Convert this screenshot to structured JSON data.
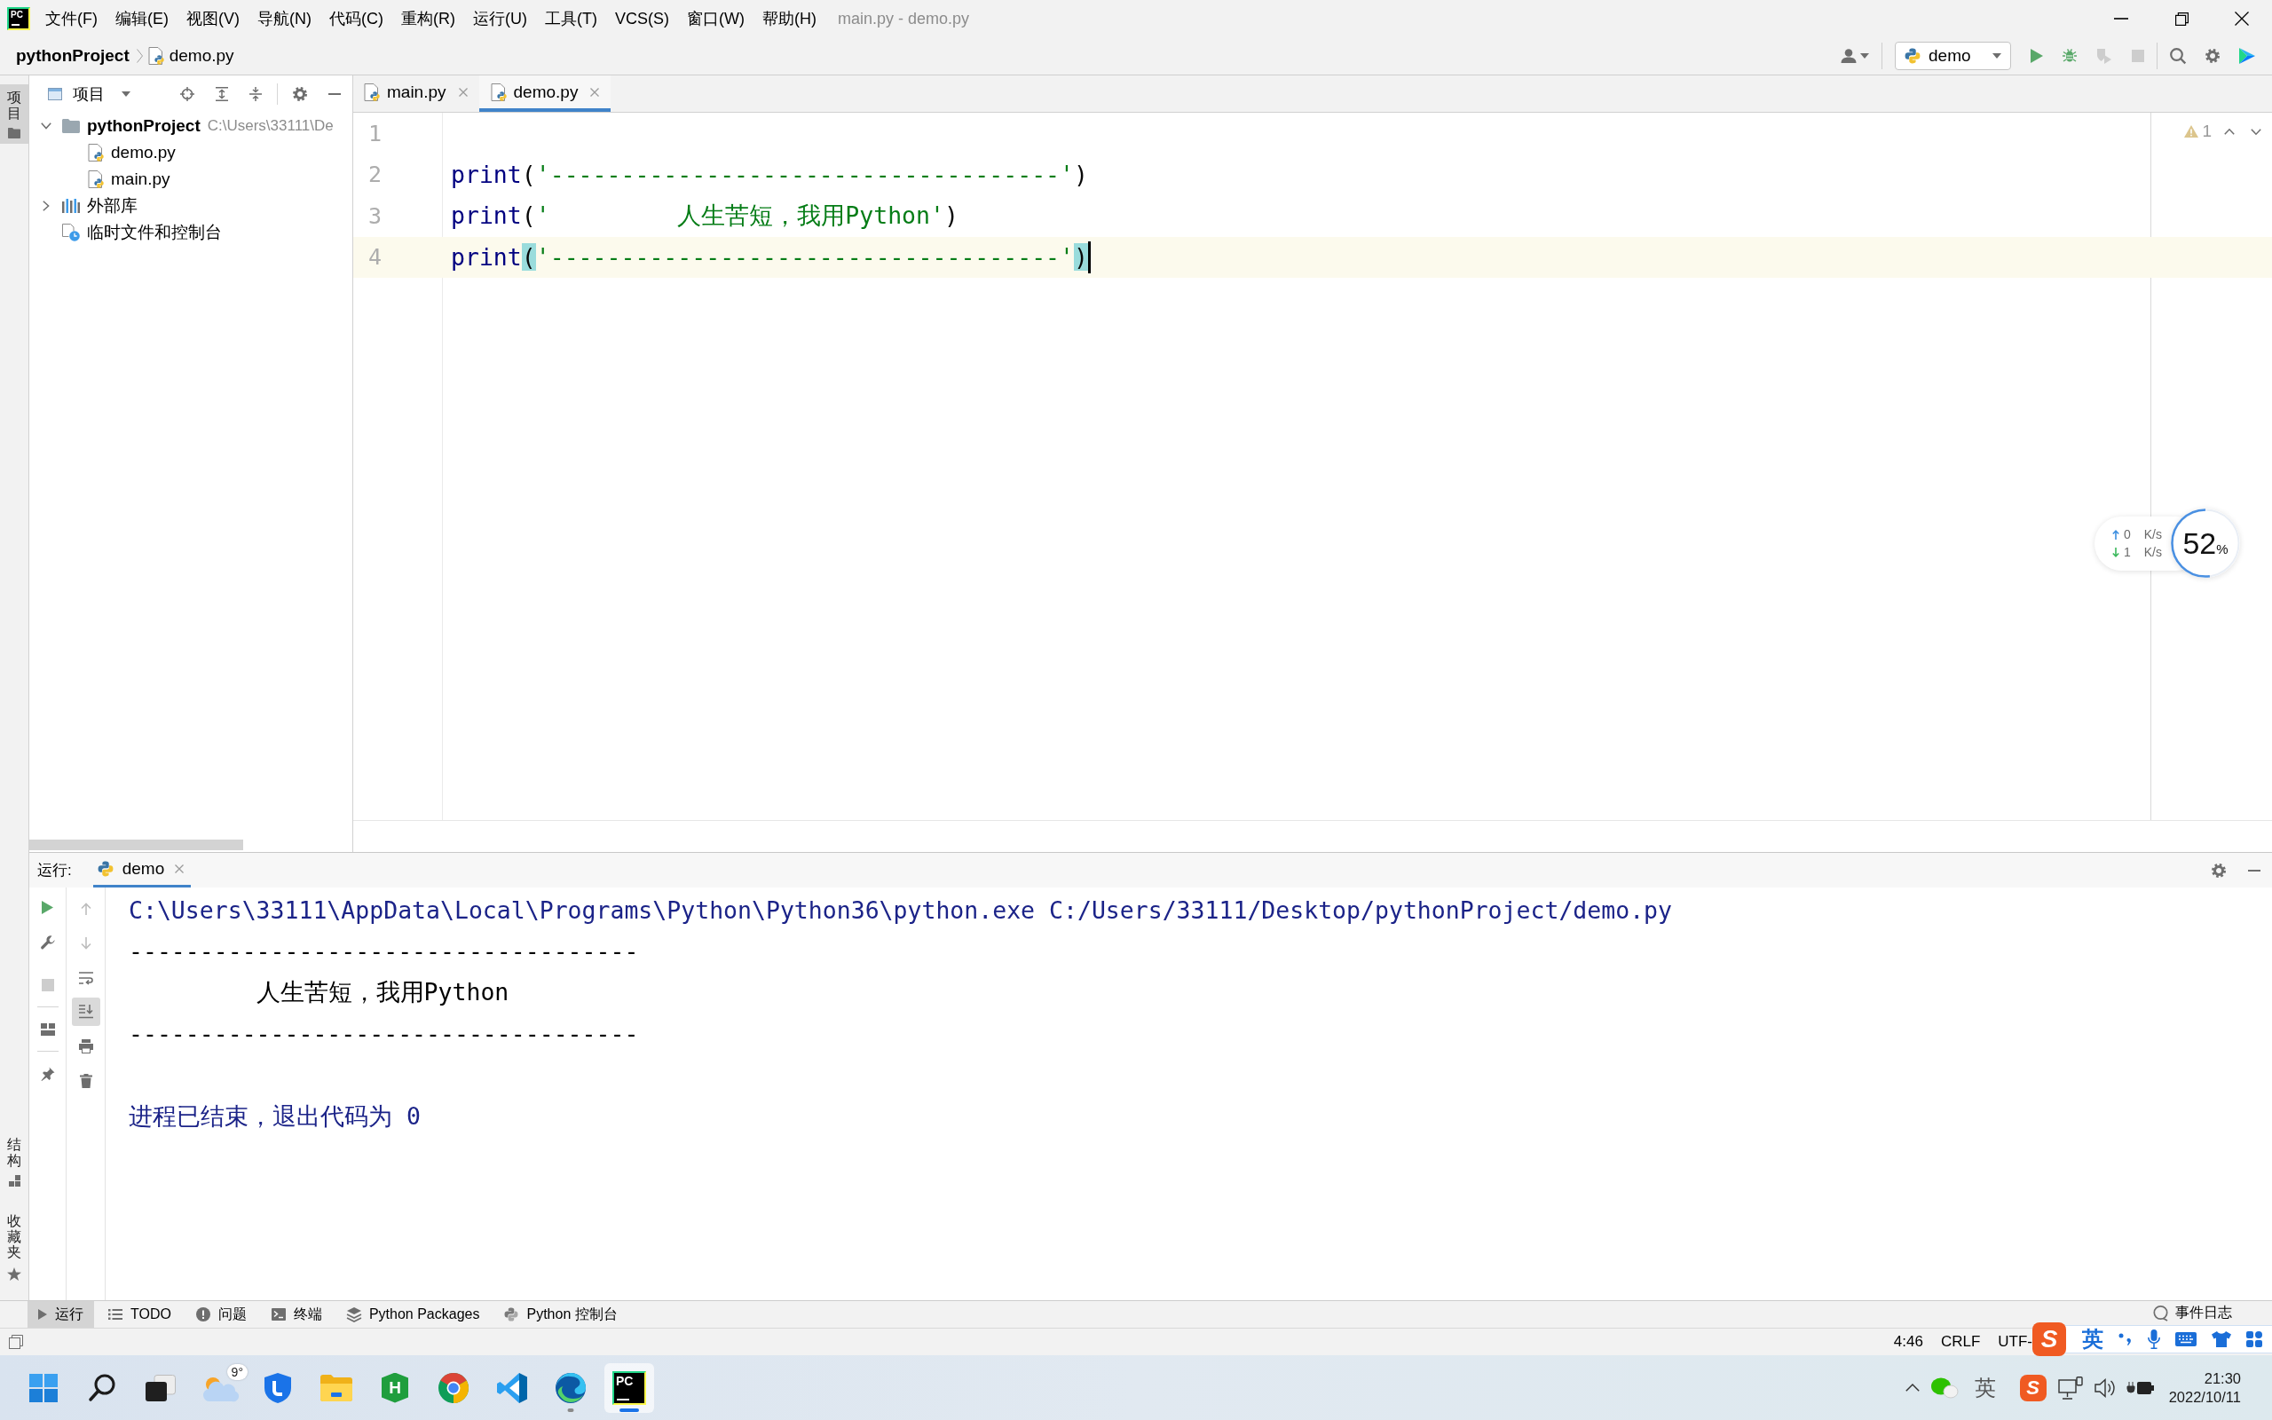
{
  "title_bar": {
    "logo": "PC",
    "menu": [
      "文件(F)",
      "编辑(E)",
      "视图(V)",
      "导航(N)",
      "代码(C)",
      "重构(R)",
      "运行(U)",
      "工具(T)",
      "VCS(S)",
      "窗口(W)",
      "帮助(H)"
    ],
    "title": "main.py - demo.py"
  },
  "nav_bar": {
    "breadcrumbs": [
      {
        "label": "pythonProject",
        "kind": "project"
      },
      {
        "label": "demo.py",
        "kind": "file"
      }
    ],
    "run_config": "demo"
  },
  "tool_stripe": {
    "top": [
      {
        "label": "项目",
        "kind": "project",
        "selected": true
      }
    ],
    "bottom": [
      {
        "label": "结构",
        "kind": "structure",
        "selected": false
      },
      {
        "label": "收藏夹",
        "kind": "favorites",
        "selected": false
      }
    ]
  },
  "project_panel": {
    "title": "项目",
    "tree": [
      {
        "label": "pythonProject",
        "kind": "folder",
        "path": "C:\\Users\\33111\\De",
        "expanded": true,
        "children": [
          {
            "label": "demo.py",
            "kind": "python"
          },
          {
            "label": "main.py",
            "kind": "python"
          }
        ]
      },
      {
        "label": "外部库",
        "kind": "library",
        "expanded": false
      },
      {
        "label": "临时文件和控制台",
        "kind": "scratch"
      }
    ]
  },
  "editor": {
    "tabs": [
      {
        "label": "main.py",
        "selected": false
      },
      {
        "label": "demo.py",
        "selected": true
      }
    ],
    "lines": [
      {
        "number": "1",
        "current": false,
        "caret": false
      },
      {
        "number": "2",
        "current": false,
        "caret": false,
        "tokens": [
          {
            "text": "print",
            "kind": "builtin",
            "matched": false
          },
          {
            "text": "(",
            "kind": "paren",
            "matched": false
          },
          {
            "text": "'------------------------------------'",
            "kind": "string",
            "matched": false
          },
          {
            "text": ")",
            "kind": "paren",
            "matched": false
          }
        ]
      },
      {
        "number": "3",
        "current": false,
        "caret": false,
        "tokens": [
          {
            "text": "print",
            "kind": "builtin",
            "matched": false
          },
          {
            "text": "(",
            "kind": "paren",
            "matched": false
          },
          {
            "text": "'         人生苦短，我用Python'",
            "kind": "string",
            "matched": false
          },
          {
            "text": ")",
            "kind": "paren",
            "matched": false
          }
        ]
      },
      {
        "number": "4",
        "current": true,
        "caret": true,
        "tokens": [
          {
            "text": "print",
            "kind": "builtin",
            "matched": false
          },
          {
            "text": "(",
            "kind": "paren",
            "matched": true
          },
          {
            "text": "'------------------------------------'",
            "kind": "string",
            "matched": false
          },
          {
            "text": ")",
            "kind": "paren",
            "matched": true
          }
        ]
      }
    ],
    "warning_count": "1"
  },
  "system_monitor": {
    "rates": [
      {
        "kind": "up",
        "value": "0",
        "unit": "K/s"
      },
      {
        "kind": "down",
        "value": "1",
        "unit": "K/s"
      }
    ],
    "percent": "52",
    "percent_sign": "%",
    "level": 0.52
  },
  "run_panel": {
    "label": "运行:",
    "tabs": [
      {
        "label": "demo",
        "selected": true
      }
    ],
    "scroll_to_end": true,
    "output": [
      {
        "text": "C:\\Users\\33111\\AppData\\Local\\Programs\\Python\\Python36\\python.exe C:/Users/33111/Desktop/pythonProject/demo.py",
        "kind": "system"
      },
      {
        "text": "------------------------------------",
        "kind": "stdout"
      },
      {
        "text": "         人生苦短，我用Python",
        "kind": "stdout"
      },
      {
        "text": "------------------------------------",
        "kind": "stdout"
      },
      {
        "text": "进程已结束，退出代码为 0",
        "kind": "exit"
      }
    ]
  },
  "tool_window_bar": {
    "items": [
      {
        "label": "运行",
        "kind": "run",
        "selected": true
      },
      {
        "label": "TODO",
        "kind": "todo",
        "selected": false
      },
      {
        "label": "问题",
        "kind": "problems",
        "selected": false
      },
      {
        "label": "终端",
        "kind": "terminal",
        "selected": false
      },
      {
        "label": "Python Packages",
        "kind": "packages",
        "selected": false
      },
      {
        "label": "Python 控制台",
        "kind": "console",
        "selected": false
      }
    ],
    "event_log": "事件日志"
  },
  "status_bar": {
    "items": [
      "4:46",
      "CRLF",
      "UTF-"
    ]
  },
  "ime_toolbar": {
    "logo": "S",
    "mode": "英"
  },
  "taskbar": {
    "apps": [
      {
        "kind": "start",
        "selected": false,
        "running": false
      },
      {
        "kind": "search",
        "selected": false,
        "running": false
      },
      {
        "kind": "task_view",
        "selected": false,
        "running": false
      },
      {
        "kind": "weather",
        "badge": "9°",
        "selected": false,
        "running": false
      },
      {
        "kind": "shield",
        "selected": false,
        "running": false
      },
      {
        "kind": "files",
        "selected": false,
        "running": false
      },
      {
        "kind": "hex_app",
        "logo": "H",
        "selected": false,
        "running": false
      },
      {
        "kind": "round_browser",
        "selected": false,
        "running": false
      },
      {
        "kind": "ribbon_editor",
        "selected": false,
        "running": false
      },
      {
        "kind": "wave_browser",
        "selected": false,
        "running": true
      },
      {
        "kind": "ide",
        "logo": "PC",
        "selected": true,
        "running": true
      }
    ],
    "tray": {
      "input_mode": "英",
      "ime_logo": "S"
    },
    "time": "21:30",
    "date": "2022/10/11"
  }
}
